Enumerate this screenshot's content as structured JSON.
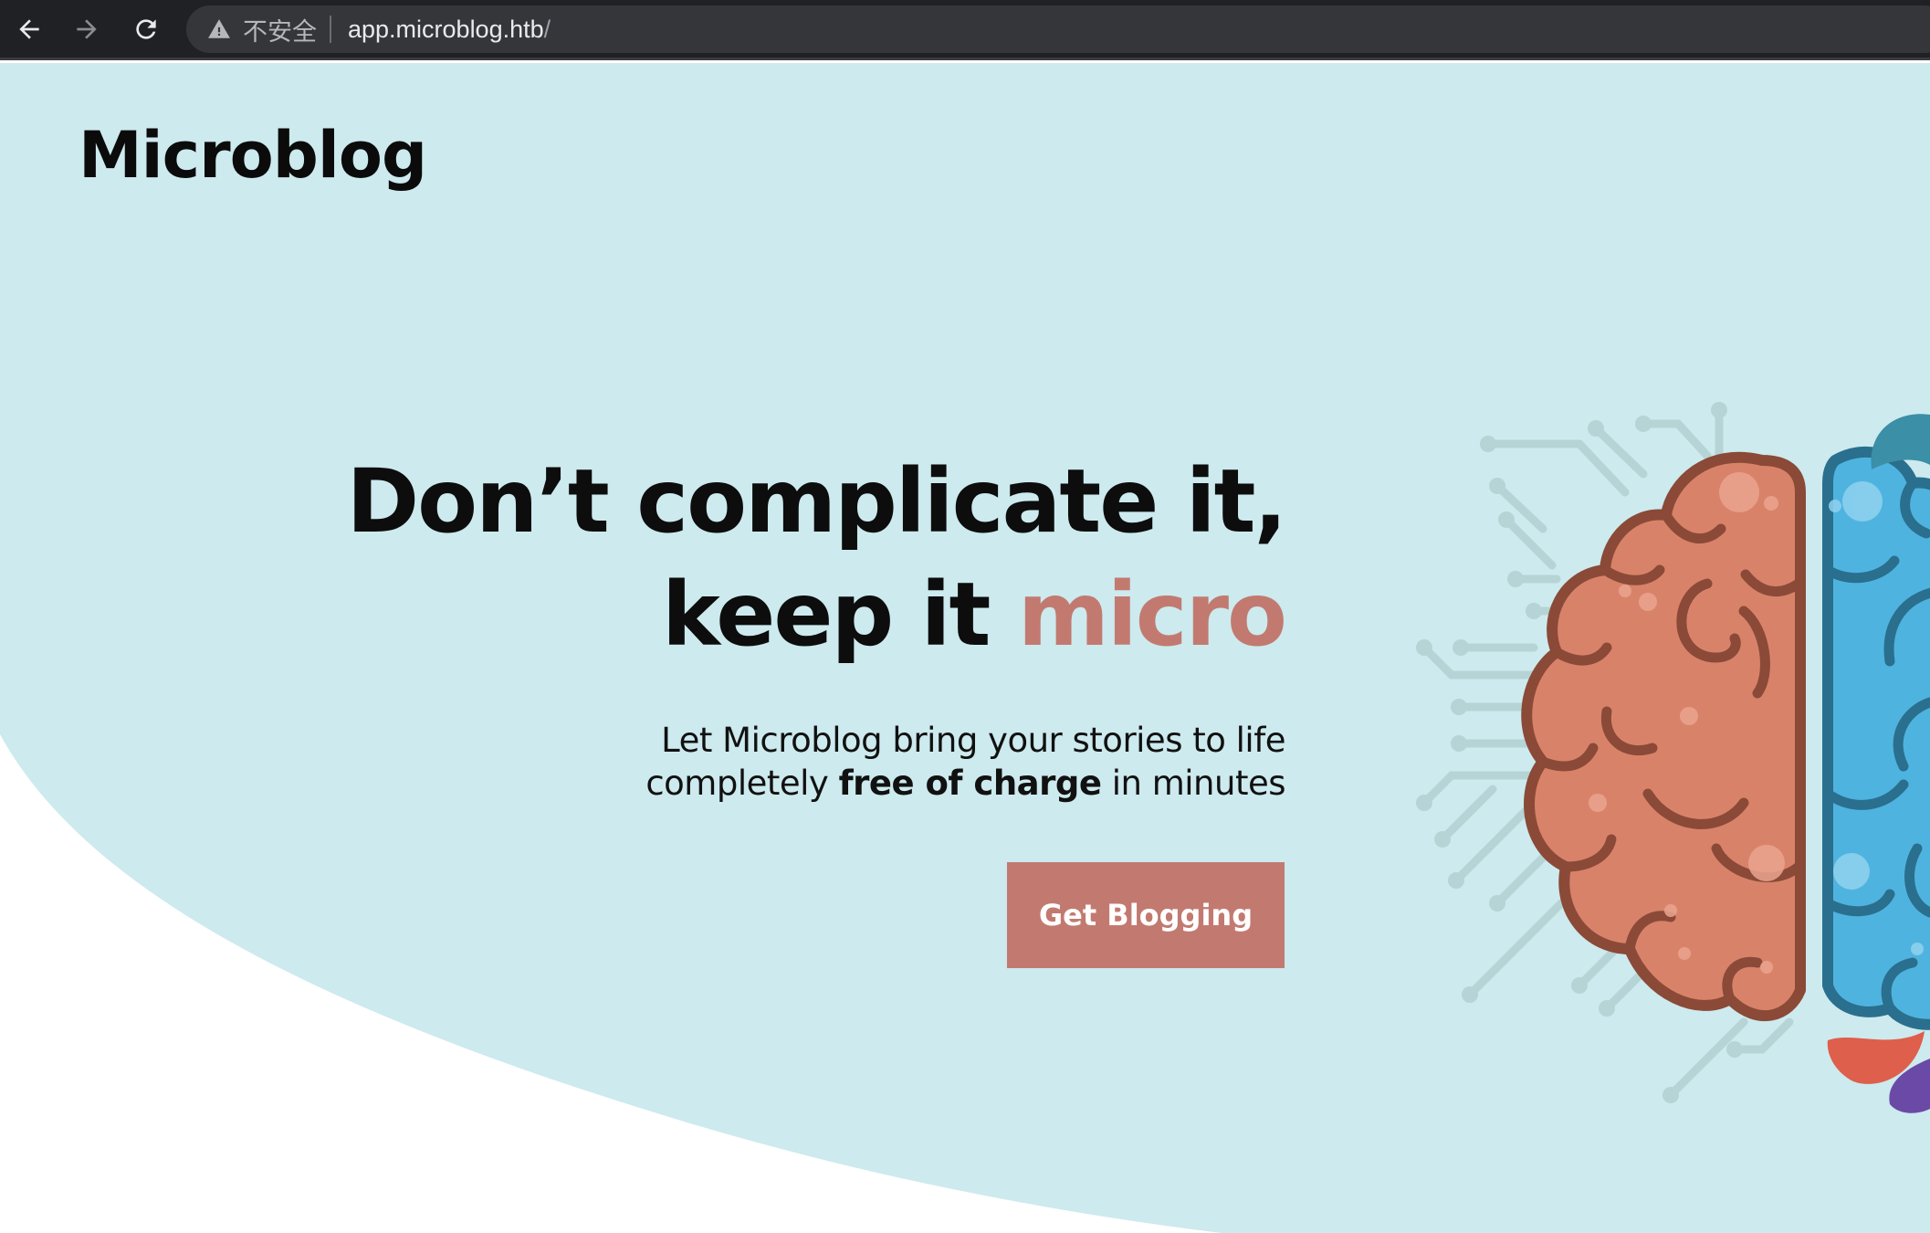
{
  "browser": {
    "security_label": "不安全",
    "url_host": "app.microblog.htb",
    "url_path": "/"
  },
  "page": {
    "brand": "Microblog",
    "headline_line1": "Don’t complicate it,",
    "headline_line2_prefix": "keep it ",
    "headline_line2_accent": "micro",
    "subtext_line1": "Let Microblog bring your stories to life",
    "subtext_line2_prefix": "completely ",
    "subtext_line2_bold": "free of charge",
    "subtext_line2_suffix": " in minutes",
    "cta_label": "Get Blogging"
  },
  "colors": {
    "hero_bg": "#cdeaee",
    "accent": "#c27a70",
    "brain_left": "#d9826a",
    "brain_right": "#4fb3df",
    "circuit": "#b6d4d6"
  },
  "icons": [
    "back-arrow-icon",
    "forward-arrow-icon",
    "reload-icon",
    "warning-icon",
    "brain-illustration"
  ]
}
